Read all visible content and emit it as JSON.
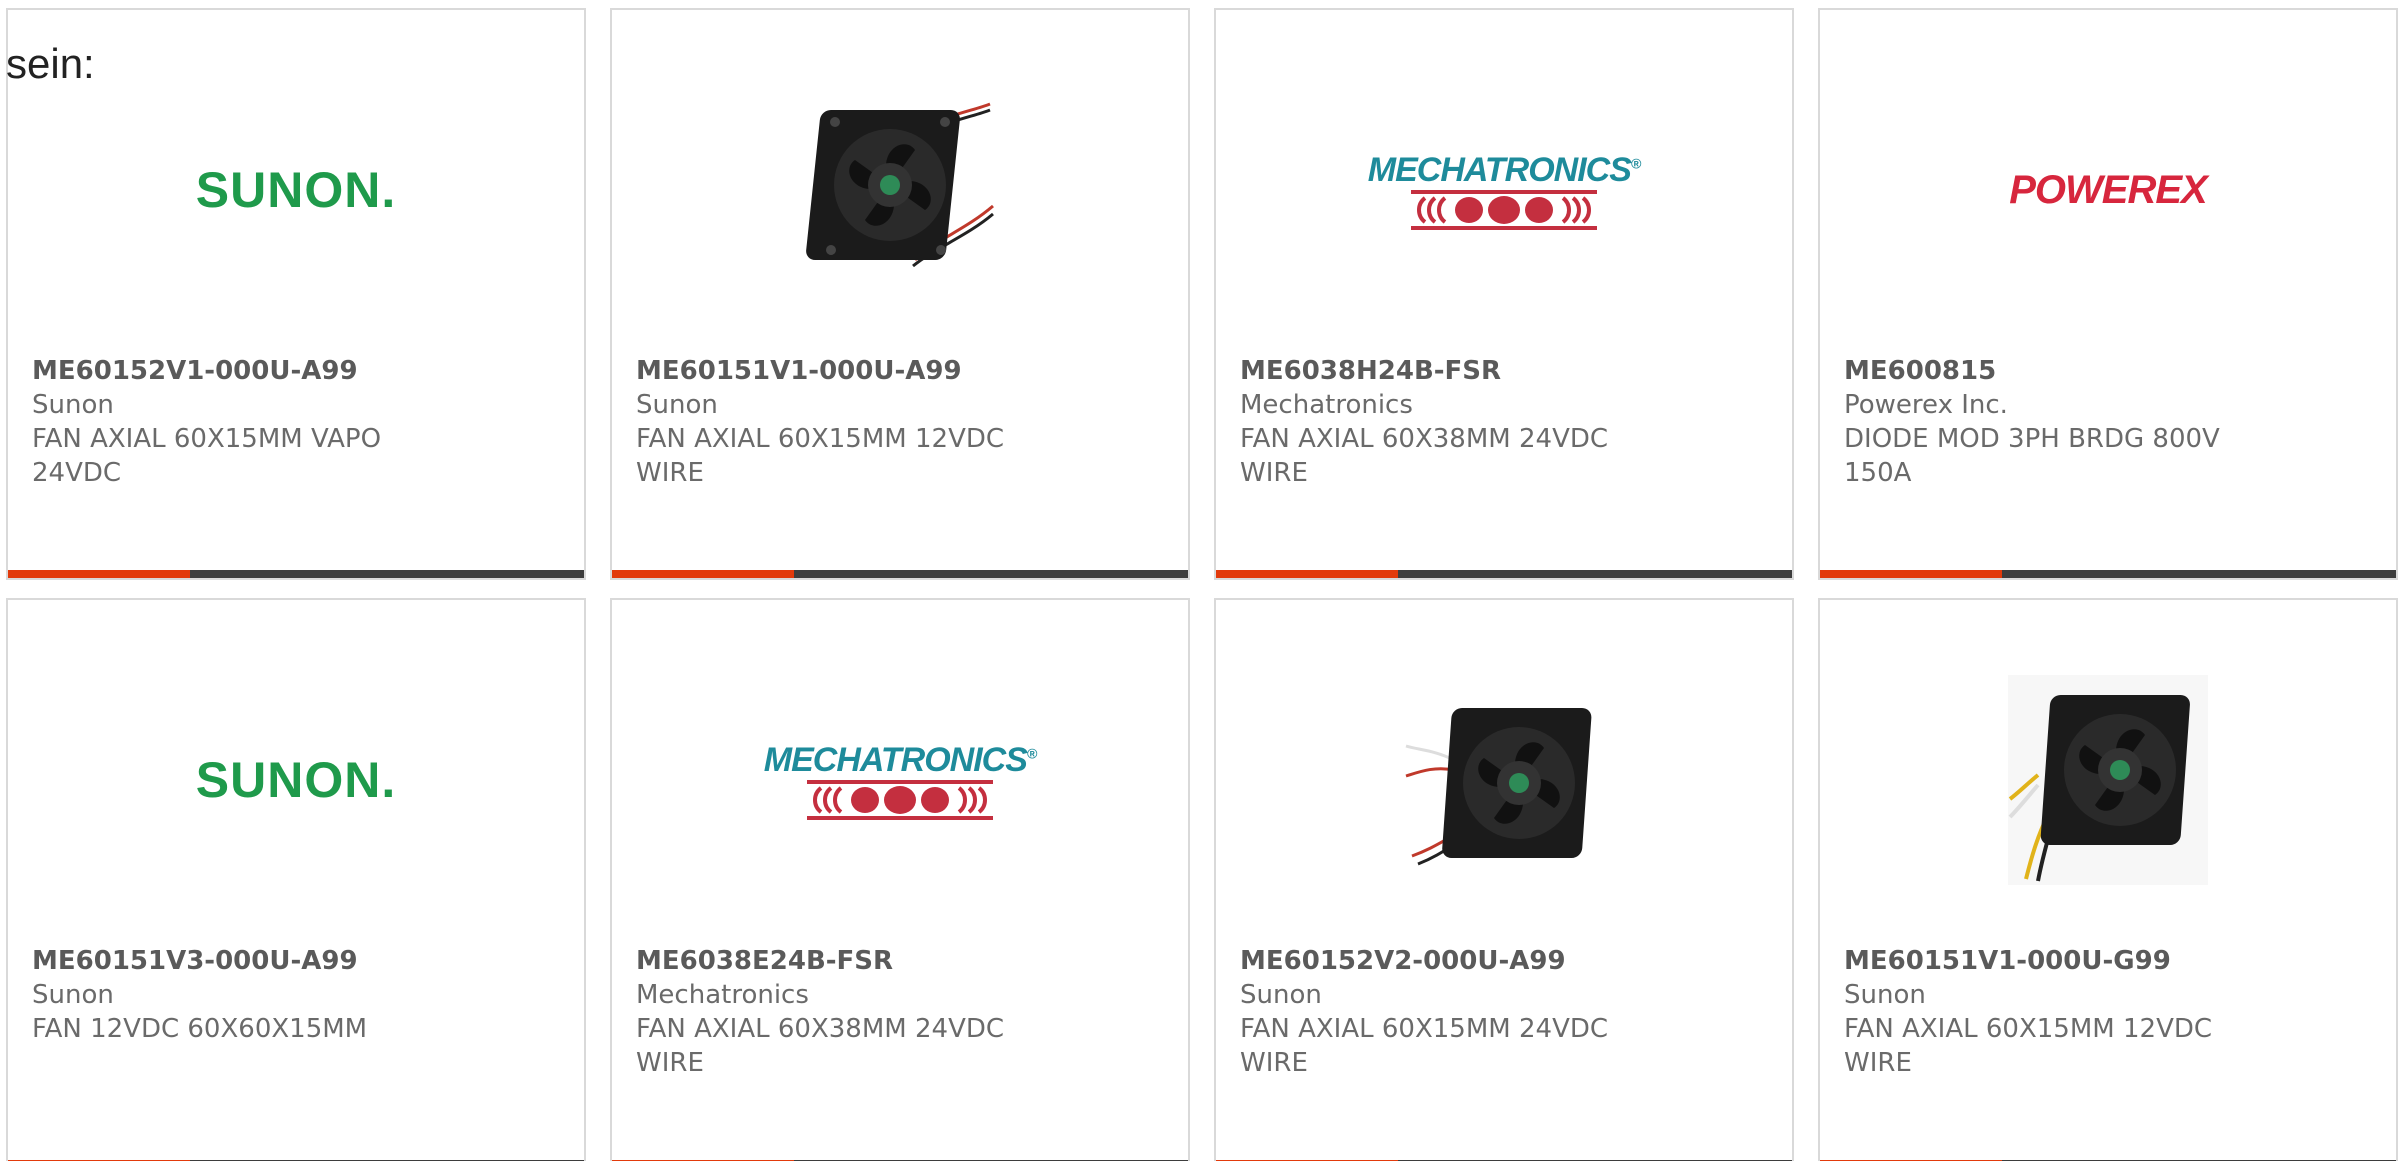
{
  "intro_text": "sein:",
  "products": [
    {
      "part_number": "ME60152V1-000U-A99",
      "manufacturer": "Sunon",
      "description": "FAN AXIAL 60X15MM VAPO 24VDC",
      "image": "sunon-logo"
    },
    {
      "part_number": "ME60151V1-000U-A99",
      "manufacturer": "Sunon",
      "description": "FAN AXIAL 60X15MM 12VDC WIRE",
      "image": "fan-photo"
    },
    {
      "part_number": "ME6038H24B-FSR",
      "manufacturer": "Mechatronics",
      "description": "FAN AXIAL 60X38MM 24VDC WIRE",
      "image": "mechatronics-logo"
    },
    {
      "part_number": "ME600815",
      "manufacturer": "Powerex Inc.",
      "description": "DIODE MOD 3PH BRDG 800V 150A",
      "image": "powerex-logo"
    },
    {
      "part_number": "ME60151V3-000U-A99",
      "manufacturer": "Sunon",
      "description": "FAN 12VDC 60X60X15MM",
      "image": "sunon-logo"
    },
    {
      "part_number": "ME6038E24B-FSR",
      "manufacturer": "Mechatronics",
      "description": "FAN AXIAL 60X38MM 24VDC WIRE",
      "image": "mechatronics-logo"
    },
    {
      "part_number": "ME60152V2-000U-A99",
      "manufacturer": "Sunon",
      "description": "FAN AXIAL 60X15MM 24VDC WIRE",
      "image": "fan-photo"
    },
    {
      "part_number": "ME60151V1-000U-G99",
      "manufacturer": "Sunon",
      "description": "FAN AXIAL 60X15MM 12VDC WIRE",
      "image": "fan-photo"
    }
  ],
  "logos": {
    "sunon": "SUNON.",
    "mechatronics": "MECHATRONICS",
    "powerex": "POWEREX"
  },
  "colors": {
    "accent": "#e23a0b",
    "bar": "#3d3d3d",
    "sunon": "#1f9a4b",
    "mechatronics_text": "#1e8b9b",
    "mechatronics_mark": "#c42f3f",
    "powerex": "#d7263d"
  }
}
